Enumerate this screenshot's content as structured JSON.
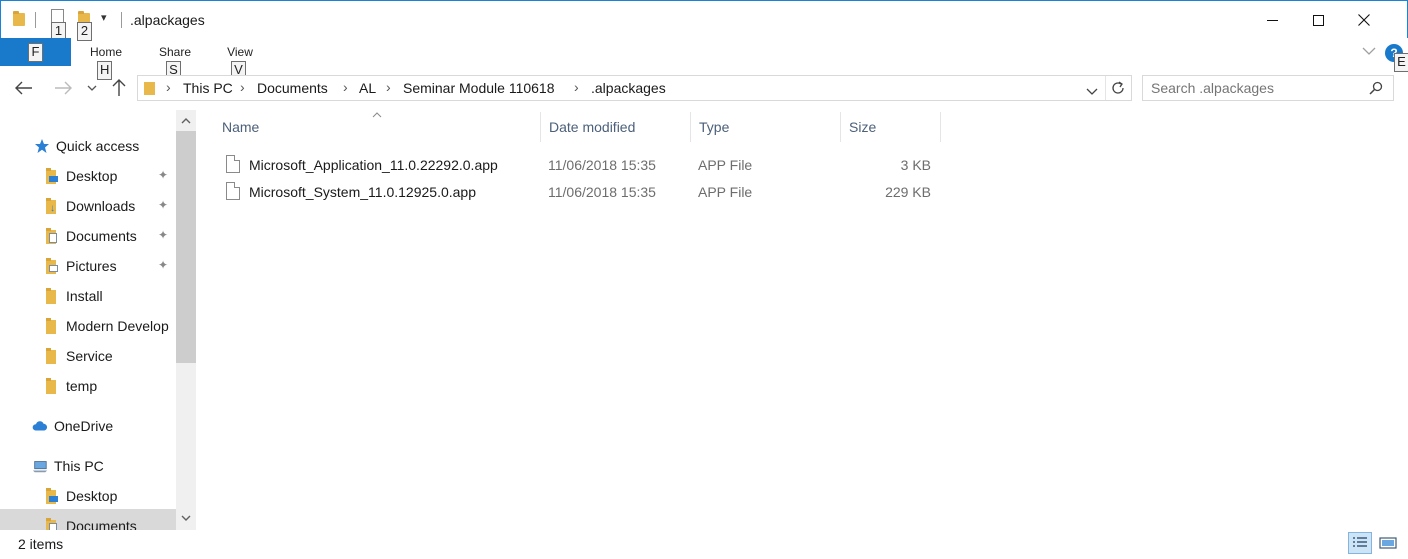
{
  "titlebar": {
    "title": ".alpackages",
    "quick_access_dropdown": "▾",
    "keytip_1": "1",
    "keytip_2": "2",
    "minimize": "—",
    "maximize": "☐",
    "close": "✕"
  },
  "ribbon": {
    "file_keytip": "F",
    "tabs": [
      {
        "label": "Home",
        "keytip": "H"
      },
      {
        "label": "Share",
        "keytip": "S"
      },
      {
        "label": "View",
        "keytip": "V"
      }
    ],
    "expand_keytip": "E",
    "help": "?"
  },
  "address": {
    "breadcrumbs": [
      "This PC",
      "Documents",
      "AL",
      "Seminar Module 110618",
      ".alpackages"
    ],
    "separator": "›"
  },
  "search": {
    "placeholder": "Search .alpackages"
  },
  "navpane": {
    "items": [
      {
        "label": "Quick access",
        "icon": "star-icon",
        "pinned": false
      },
      {
        "label": "Desktop",
        "icon": "desktop-folder-icon",
        "pinned": true
      },
      {
        "label": "Downloads",
        "icon": "downloads-folder-icon",
        "pinned": true
      },
      {
        "label": "Documents",
        "icon": "documents-folder-icon",
        "pinned": true
      },
      {
        "label": "Pictures",
        "icon": "pictures-folder-icon",
        "pinned": true
      },
      {
        "label": "Install",
        "icon": "folder-icon",
        "pinned": false
      },
      {
        "label": "Modern Develop",
        "icon": "folder-icon",
        "pinned": false
      },
      {
        "label": "Service",
        "icon": "folder-icon",
        "pinned": false
      },
      {
        "label": "temp",
        "icon": "folder-icon",
        "pinned": false
      },
      {
        "label": "OneDrive",
        "icon": "cloud-icon",
        "pinned": false
      },
      {
        "label": "This PC",
        "icon": "computer-icon",
        "pinned": false
      },
      {
        "label": "Desktop",
        "icon": "desktop-folder-icon",
        "pinned": false
      },
      {
        "label": "Documents",
        "icon": "documents-folder-icon",
        "pinned": false
      }
    ],
    "pin_glyph": "📌"
  },
  "filelist": {
    "columns": [
      "Name",
      "Date modified",
      "Type",
      "Size"
    ],
    "rows": [
      {
        "name": "Microsoft_Application_11.0.22292.0.app",
        "date": "11/06/2018 15:35",
        "type": "APP File",
        "size": "3 KB"
      },
      {
        "name": "Microsoft_System_11.0.12925.0.app",
        "date": "11/06/2018 15:35",
        "type": "APP File",
        "size": "229 KB"
      }
    ]
  },
  "statusbar": {
    "item_count": "2 items"
  },
  "colors": {
    "accent": "#1979ca",
    "header_text": "#4c607a",
    "folder": "#e8b84a"
  }
}
